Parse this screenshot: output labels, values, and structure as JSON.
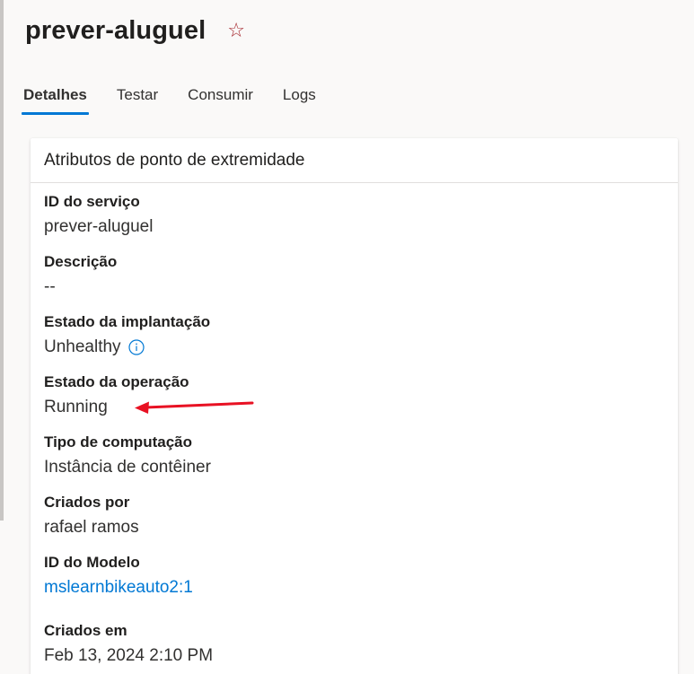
{
  "header": {
    "title": "prever-aluguel",
    "favorite_icon": "star-outline-icon"
  },
  "tabs": [
    {
      "label": "Detalhes",
      "active": true
    },
    {
      "label": "Testar",
      "active": false
    },
    {
      "label": "Consumir",
      "active": false
    },
    {
      "label": "Logs",
      "active": false
    }
  ],
  "card": {
    "title": "Atributos de ponto de extremidade",
    "fields": [
      {
        "label": "ID do serviço",
        "value": "prever-aluguel"
      },
      {
        "label": "Descrição",
        "value": "--"
      },
      {
        "label": "Estado da implantação",
        "value": "Unhealthy",
        "icon": "info-icon"
      },
      {
        "label": "Estado da operação",
        "value": "Running"
      },
      {
        "label": "Tipo de computação",
        "value": "Instância de contêiner"
      },
      {
        "label": "Criados por",
        "value": "rafael ramos"
      },
      {
        "label": "ID do Modelo",
        "value": "mslearnbikeauto2:1",
        "link": true
      },
      {
        "label": "Criados em",
        "value": "Feb 13, 2024 2:10 PM"
      }
    ]
  },
  "annotation": {
    "arrow_color": "#e81123"
  },
  "colors": {
    "accent": "#0078d4",
    "star": "#a4262c"
  }
}
